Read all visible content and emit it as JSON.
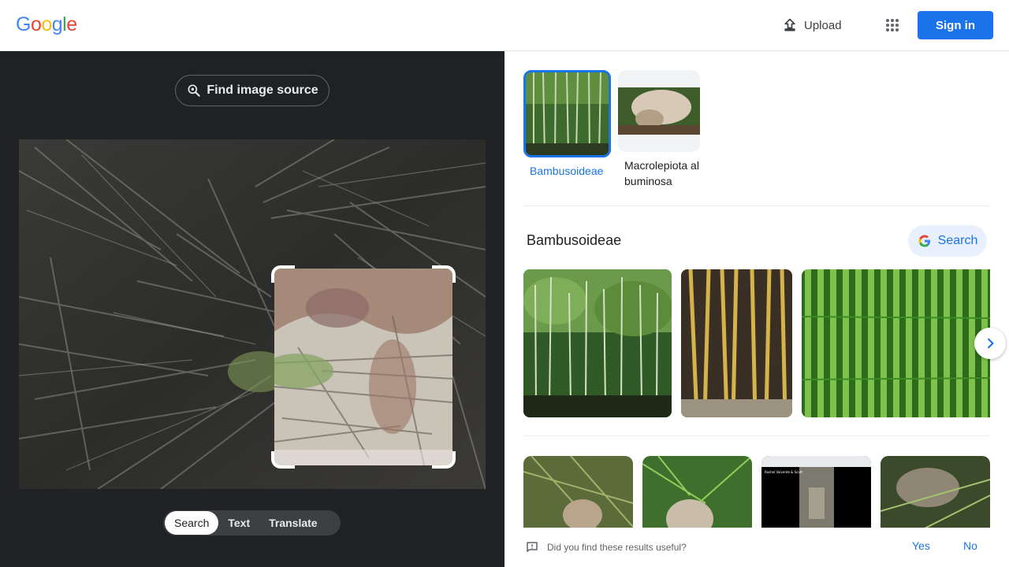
{
  "header": {
    "logo_letters": [
      {
        "ch": "G",
        "color": "#4285f4"
      },
      {
        "ch": "o",
        "color": "#ea4335"
      },
      {
        "ch": "o",
        "color": "#fbbc05"
      },
      {
        "ch": "g",
        "color": "#4285f4"
      },
      {
        "ch": "l",
        "color": "#34a853"
      },
      {
        "ch": "e",
        "color": "#ea4335"
      }
    ],
    "upload_label": "Upload",
    "apps_icon": "apps-grid-icon",
    "signin_label": "Sign in"
  },
  "left": {
    "find_source_label": "Find image source",
    "find_source_icon": "lens-search-icon",
    "tabs": [
      {
        "label": "Search",
        "active": true
      },
      {
        "label": "Text",
        "active": false
      },
      {
        "label": "Translate",
        "active": false
      }
    ]
  },
  "right": {
    "entities": [
      {
        "label": "Bambusoideae",
        "selected": true
      },
      {
        "label": "Macrolepiota albuminosa",
        "selected": false
      }
    ],
    "section_title": "Bambusoideae",
    "search_chip_label": "Search",
    "third_thumb_caption": "Roshel Valverde & Scott",
    "feedback": {
      "question": "Did you find these results useful?",
      "yes": "Yes",
      "no": "No"
    }
  },
  "colors": {
    "accent": "#1a73e8",
    "dark_panel": "#202124"
  }
}
